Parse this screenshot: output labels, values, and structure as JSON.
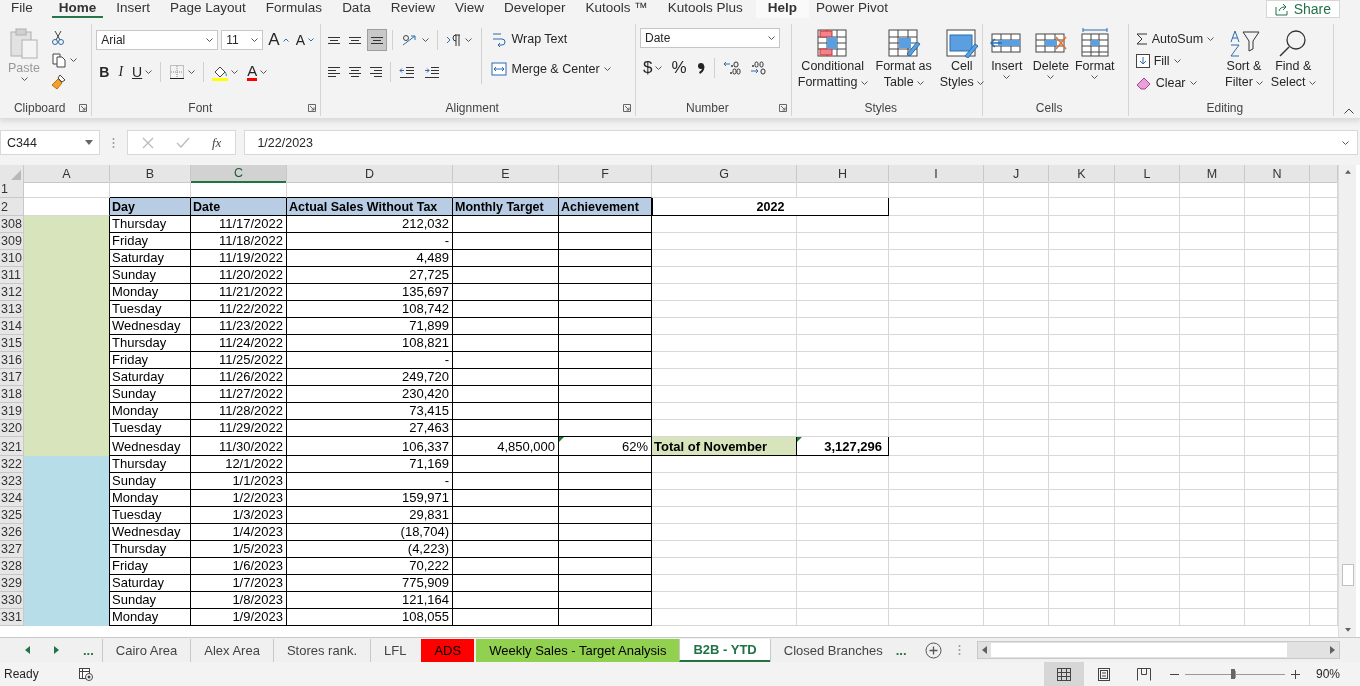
{
  "menu_tabs": [
    {
      "label": "File",
      "selected": false,
      "hovered": false
    },
    {
      "label": "Home",
      "selected": true,
      "hovered": false
    },
    {
      "label": "Insert",
      "selected": false,
      "hovered": false
    },
    {
      "label": "Page Layout",
      "selected": false,
      "hovered": false
    },
    {
      "label": "Formulas",
      "selected": false,
      "hovered": false
    },
    {
      "label": "Data",
      "selected": false,
      "hovered": false
    },
    {
      "label": "Review",
      "selected": false,
      "hovered": false
    },
    {
      "label": "View",
      "selected": false,
      "hovered": false
    },
    {
      "label": "Developer",
      "selected": false,
      "hovered": false
    },
    {
      "label": "Kutools ™",
      "selected": false,
      "hovered": false
    },
    {
      "label": "Kutools Plus",
      "selected": false,
      "hovered": false
    },
    {
      "label": "Help",
      "selected": false,
      "hovered": true
    },
    {
      "label": "Power Pivot",
      "selected": false,
      "hovered": false
    }
  ],
  "share_button": "Share",
  "ribbon": {
    "clipboard": {
      "label": "Clipboard",
      "paste": "Paste"
    },
    "font": {
      "label": "Font",
      "font_name": "Arial",
      "font_size": "11",
      "grow": "A",
      "shrink": "A",
      "bold": "B",
      "italic": "I",
      "underline": "U",
      "font_color": "A"
    },
    "alignment": {
      "label": "Alignment",
      "wrap_text": "Wrap Text",
      "merge": "Merge & Center"
    },
    "number": {
      "label": "Number",
      "format": "Date",
      "currency": "$",
      "percent": "%"
    },
    "styles": {
      "label": "Styles",
      "buttons": [
        {
          "kind": "conditional",
          "line1": "Conditional",
          "line2": "Formatting"
        },
        {
          "kind": "table",
          "line1": "Format as",
          "line2": "Table"
        },
        {
          "kind": "cellstyles",
          "line1": "Cell",
          "line2": "Styles"
        }
      ]
    },
    "cells": {
      "label": "Cells",
      "buttons": [
        {
          "kind": "insert",
          "label": "Insert"
        },
        {
          "kind": "delete",
          "label": "Delete"
        },
        {
          "kind": "format",
          "label": "Format"
        }
      ]
    },
    "editing": {
      "label": "Editing",
      "autosum": "AutoSum",
      "fill": "Fill",
      "clear": "Clear",
      "sort": {
        "line1": "Sort &",
        "line2": "Filter"
      },
      "find": {
        "line1": "Find &",
        "line2": "Select"
      }
    }
  },
  "formula_bar": {
    "name_box": "C344",
    "function_label": "fx",
    "formula": "1/22/2023"
  },
  "sheet": {
    "columns": [
      {
        "label": "A",
        "selected": false
      },
      {
        "label": "B",
        "selected": false
      },
      {
        "label": "C",
        "selected": true
      },
      {
        "label": "D",
        "selected": false
      },
      {
        "label": "E",
        "selected": false
      },
      {
        "label": "F",
        "selected": false
      },
      {
        "label": "G",
        "selected": false
      },
      {
        "label": "H",
        "selected": false
      },
      {
        "label": "I",
        "selected": false
      },
      {
        "label": "J",
        "selected": false
      },
      {
        "label": "K",
        "selected": false
      },
      {
        "label": "L",
        "selected": false
      },
      {
        "label": "M",
        "selected": false
      },
      {
        "label": "N",
        "selected": false
      }
    ],
    "header_rows": [
      "1",
      "2"
    ],
    "headers": [
      "Day",
      "Date",
      "Actual Sales Without Tax",
      "Monthly Target",
      "Achievement"
    ],
    "year_heading": "2022",
    "rows": [
      {
        "n": "308",
        "color": "#d8e4bc",
        "day": "Thursday",
        "date": "11/17/2022",
        "sales": "212,032"
      },
      {
        "n": "309",
        "color": "#d8e4bc",
        "day": "Friday",
        "date": "11/18/2022",
        "sales": "-"
      },
      {
        "n": "310",
        "color": "#d8e4bc",
        "day": "Saturday",
        "date": "11/19/2022",
        "sales": "4,489"
      },
      {
        "n": "311",
        "color": "#d8e4bc",
        "day": "Sunday",
        "date": "11/20/2022",
        "sales": "27,725"
      },
      {
        "n": "312",
        "color": "#d8e4bc",
        "day": "Monday",
        "date": "11/21/2022",
        "sales": "135,697"
      },
      {
        "n": "313",
        "color": "#d8e4bc",
        "day": "Tuesday",
        "date": "11/22/2022",
        "sales": "108,742"
      },
      {
        "n": "314",
        "color": "#d8e4bc",
        "day": "Wednesday",
        "date": "11/23/2022",
        "sales": "71,899"
      },
      {
        "n": "315",
        "color": "#d8e4bc",
        "day": "Thursday",
        "date": "11/24/2022",
        "sales": "108,821"
      },
      {
        "n": "316",
        "color": "#d8e4bc",
        "day": "Friday",
        "date": "11/25/2022",
        "sales": "-"
      },
      {
        "n": "317",
        "color": "#d8e4bc",
        "day": "Saturday",
        "date": "11/26/2022",
        "sales": "249,720"
      },
      {
        "n": "318",
        "color": "#d8e4bc",
        "day": "Sunday",
        "date": "11/27/2022",
        "sales": "230,420"
      },
      {
        "n": "319",
        "color": "#d8e4bc",
        "day": "Monday",
        "date": "11/28/2022",
        "sales": "73,415"
      },
      {
        "n": "320",
        "color": "#d8e4bc",
        "day": "Tuesday",
        "date": "11/29/2022",
        "sales": "27,463"
      },
      {
        "n": "321",
        "color": "#d8e4bc",
        "day": "Wednesday",
        "date": "11/30/2022",
        "sales": "106,337",
        "target": "4,850,000",
        "achievement": "62%",
        "achievement_flag": true,
        "total_label": "Total of November",
        "total_value": "3,127,296",
        "total_flag": true
      },
      {
        "n": "322",
        "color": "#b7dde8",
        "day": "Thursday",
        "date": "12/1/2022",
        "sales": "71,169"
      },
      {
        "n": "323",
        "color": "#b7dde8",
        "day": "Sunday",
        "date": "1/1/2023",
        "sales": "-"
      },
      {
        "n": "324",
        "color": "#b7dde8",
        "day": "Monday",
        "date": "1/2/2023",
        "sales": "159,971"
      },
      {
        "n": "325",
        "color": "#b7dde8",
        "day": "Tuesday",
        "date": "1/3/2023",
        "sales": "29,831"
      },
      {
        "n": "326",
        "color": "#b7dde8",
        "day": "Wednesday",
        "date": "1/4/2023",
        "sales": "(18,704)"
      },
      {
        "n": "327",
        "color": "#b7dde8",
        "day": "Thursday",
        "date": "1/5/2023",
        "sales": "(4,223)"
      },
      {
        "n": "328",
        "color": "#b7dde8",
        "day": "Friday",
        "date": "1/6/2023",
        "sales": "70,222"
      },
      {
        "n": "329",
        "color": "#b7dde8",
        "day": "Saturday",
        "date": "1/7/2023",
        "sales": "775,909"
      },
      {
        "n": "330",
        "color": "#b7dde8",
        "day": "Sunday",
        "date": "1/8/2023",
        "sales": "121,164"
      },
      {
        "n": "331",
        "color": "#b7dde8",
        "day": "Monday",
        "date": "1/9/2023",
        "sales": "108,055"
      }
    ]
  },
  "sheet_tabs": {
    "more_left": "...",
    "more_right": "...",
    "tabs": [
      {
        "label": "Cairo Area",
        "selected": false
      },
      {
        "label": "Alex Area",
        "selected": false
      },
      {
        "label": "Stores rank.",
        "selected": false
      },
      {
        "label": "LFL",
        "selected": false
      },
      {
        "label": "ADS",
        "selected": false,
        "color": "#ff0000"
      },
      {
        "label": "Weekly Sales - Target Analysis",
        "selected": false,
        "color": "#92d050"
      },
      {
        "label": "B2B - YTD",
        "selected": true
      },
      {
        "label": "Closed Branches",
        "selected": false
      }
    ]
  },
  "status_bar": {
    "status": "Ready",
    "views": [
      {
        "kind": "normal",
        "selected": true
      },
      {
        "kind": "page_layout",
        "selected": false
      },
      {
        "kind": "page_break",
        "selected": false
      }
    ],
    "zoom_slider": {
      "level": 0.48
    },
    "zoom": "90%"
  }
}
